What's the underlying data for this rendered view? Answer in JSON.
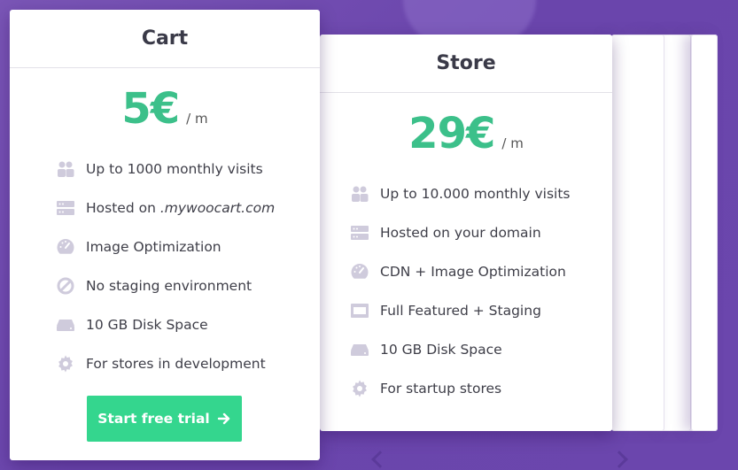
{
  "colors": {
    "background": "#6c47ad",
    "price": "#3cc08a",
    "cta": "#34d68e",
    "icon": "#cfcbdc"
  },
  "cart_plan": {
    "title": "Cart",
    "price": "5€",
    "per": "/ m",
    "features": [
      {
        "icon": "users-icon",
        "text": "Up to 1000 monthly visits"
      },
      {
        "icon": "server-icon",
        "text": "Hosted on ",
        "italic": ".mywoocart.com"
      },
      {
        "icon": "speedometer-icon",
        "text": "Image Optimization"
      },
      {
        "icon": "ban-icon",
        "text": "No staging environment"
      },
      {
        "icon": "hard-drive-icon",
        "text": "10 GB Disk Space"
      },
      {
        "icon": "gear-icon",
        "text": "For stores in development"
      }
    ],
    "cta_label": "Start free trial"
  },
  "store_plan": {
    "title": "Store",
    "price": "29€",
    "per": "/ m",
    "features": [
      {
        "icon": "users-icon",
        "text": "Up to 10.000 monthly visits"
      },
      {
        "icon": "server-icon",
        "text": "Hosted on your domain"
      },
      {
        "icon": "speedometer-icon",
        "text": "CDN + Image Optimization"
      },
      {
        "icon": "window-icon",
        "text": "Full Featured + Staging"
      },
      {
        "icon": "hard-drive-icon",
        "text": "10 GB Disk Space"
      },
      {
        "icon": "gear-icon",
        "text": "For startup stores"
      }
    ]
  }
}
